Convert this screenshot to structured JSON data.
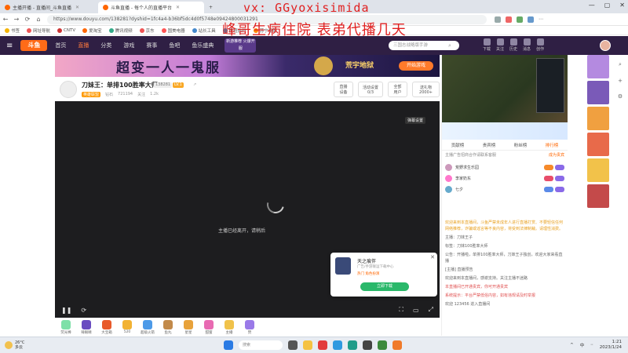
{
  "browser": {
    "tabs": [
      {
        "label": "主播开播 - 直播间_斗鱼直播",
        "active": false
      },
      {
        "label": "斗鱼直播 - 每个人的直播平台",
        "active": true
      },
      {
        "label": "+",
        "active": false
      }
    ],
    "url": "https://www.douyu.com/138281?dyshid=1fc4a4-b36bf5dc4d0f5748e09424800031291",
    "window_controls": [
      "—",
      "▢",
      "✕"
    ],
    "bookmarks": [
      "书签",
      "网址导航",
      "CNTV",
      "爱淘宝",
      "腾讯视频",
      "京东",
      "国美电器",
      "站长工具",
      "携程旅行",
      "苏宁易购"
    ]
  },
  "watermark": {
    "line1": "vx: GGyoxisimida",
    "line2": "峰哥生病住院 表弟代播几天"
  },
  "site": {
    "logo": "斗鱼",
    "nav": [
      {
        "label": "首页",
        "active": false
      },
      {
        "label": "直播",
        "active": true
      },
      {
        "label": "分类",
        "active": false
      },
      {
        "label": "游戏",
        "active": false
      },
      {
        "label": "赛事",
        "active": false
      },
      {
        "label": "鱼吧",
        "active": false
      },
      {
        "label": "鱼乐盛典",
        "active": false
      }
    ],
    "game_promo": "新游推荐 火爆开服",
    "search_placeholder": "三国志战略版手游",
    "user_icons": [
      "下载",
      "关注",
      "历史",
      "消息",
      "创作"
    ]
  },
  "banner": {
    "text": "超变一人一鬼服",
    "title": "荒宇地狱",
    "button": "开始游戏"
  },
  "room": {
    "title": "刀妹王：单排100胜率大师",
    "id_badge": "138281",
    "level_badge": "LV.1",
    "meta": [
      "英雄联盟",
      "钻石",
      "721194",
      "关注",
      "1.2k"
    ],
    "actions": [
      "直播设备",
      "活动设置 0/3",
      "全部用户",
      "送礼物 2000+"
    ]
  },
  "video": {
    "loading_text": "主播已经离开，请稍后",
    "corner_tag": "弹幕设置",
    "controls_left": [
      "❚❚",
      "⟳"
    ],
    "controls_right": [
      "⛶",
      "▭",
      "⤢"
    ]
  },
  "popup": {
    "title": "天之痕伴",
    "sub": "广告/手游联运下载中心",
    "tag": "热门 角色扮演",
    "button": "立即下载",
    "close": "✕"
  },
  "gifts": [
    "荧光棒",
    "辣眼睛",
    "大宝箱",
    "520",
    "超级火箭",
    "鱼丸",
    "星星",
    "甜蜜",
    "主播",
    "赞"
  ],
  "right_panel": {
    "tabs": [
      {
        "label": "贡献榜",
        "active": false
      },
      {
        "label": "贵宾榜",
        "active": false
      },
      {
        "label": "粉丝榜",
        "active": false
      },
      {
        "label": "排行榜",
        "active": true
      }
    ],
    "notice": "主播广告招商合作请联系客服",
    "notice_link": "成为贵宾",
    "ranks": [
      {
        "name": "荒野求生乐园",
        "color": "#f68a2a"
      },
      {
        "name": "李家奶东",
        "color": "#e84d6a"
      },
      {
        "name": "七夕",
        "color": "#5a8ae8"
      }
    ],
    "chat": [
      {
        "text": "欢迎来到本直播间，斗鱼严禁未成年人进行直播打赏、不要轻信任何网络推荐，诈骗或谣言等不良内容，将受到法律制裁。请理性消费。",
        "kind": "sys"
      },
      {
        "text": "主播：刀妹王子",
        "kind": "normal"
      },
      {
        "text": "标签：刀妹100胜率大师",
        "kind": "normal"
      },
      {
        "text": "公告：开播啦，单排100胜率大师，刀妹王子独创，欢迎大家来看直播",
        "kind": "normal"
      },
      {
        "text": "[主播] 直播预告",
        "kind": "normal"
      },
      {
        "text": "欢迎来到本直播间，感谢支持。关注主播不迷路",
        "kind": "normal"
      },
      {
        "text": "本直播间已开通贵宾，你可开通贵宾",
        "kind": "hl"
      },
      {
        "text": "系统提示：平台严禁低俗内容，如有违规请及时举报",
        "kind": "hl"
      },
      {
        "text": "欢迎 123456 进入直播间",
        "kind": "normal"
      }
    ]
  },
  "taskbar": {
    "weather_temp": "26°C",
    "weather_desc": "多云",
    "search_placeholder": "搜索",
    "tray": [
      "^",
      "中",
      "⋅⋅"
    ],
    "time": "1:21",
    "date": "2023/1/24"
  },
  "colors": {
    "site_header": "#2f1f44",
    "accent": "#ff7a3d",
    "watermark": "#e02020"
  }
}
